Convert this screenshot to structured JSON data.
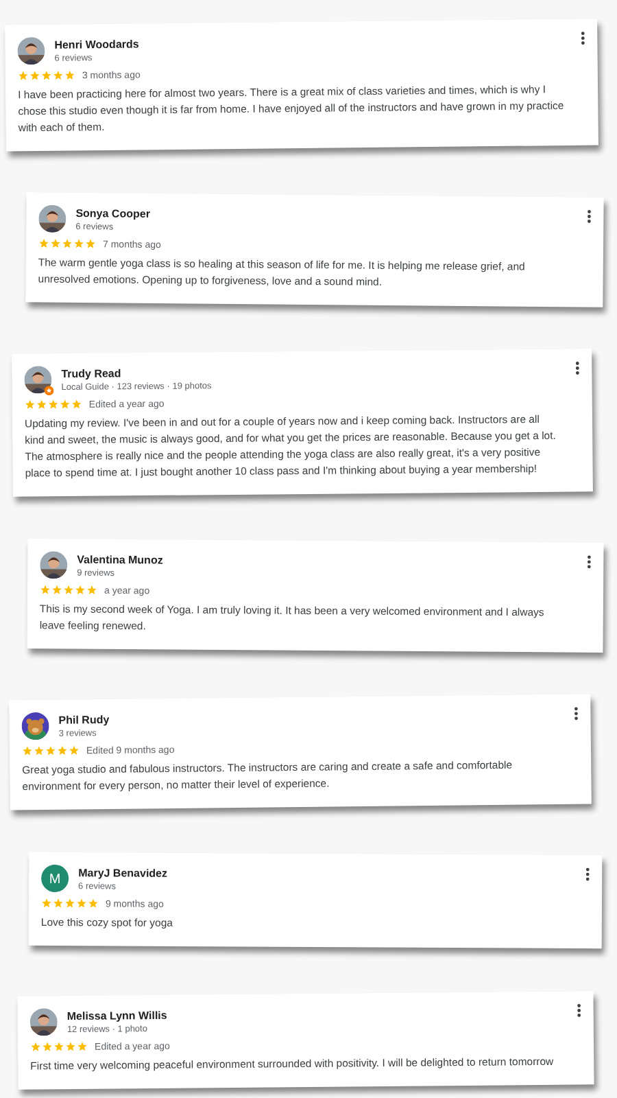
{
  "reviews": [
    {
      "name": "Henri Woodards",
      "meta": "6 reviews",
      "local_guide": false,
      "stars": 5,
      "time": "3 months ago",
      "text": "I have been practicing here for almost two years. There is a great mix of class varieties and times, which is why I chose this studio even though it is far from home. I have enjoyed all of the instructors and have grown in my practice with each of them."
    },
    {
      "name": "Sonya Cooper",
      "meta": "6 reviews",
      "local_guide": false,
      "stars": 5,
      "time": "7 months ago",
      "text": "The warm gentle yoga class is so healing at this season of life for me. It is helping me release grief, and unresolved emotions. Opening up to forgiveness, love and a sound mind."
    },
    {
      "name": "Trudy Read",
      "meta": "Local Guide · 123 reviews · 19 photos",
      "local_guide": true,
      "stars": 5,
      "time": "Edited a year ago",
      "text": "Updating my review. I've been in and out for a couple of years now and i keep coming back. Instructors are all kind and sweet, the music is always good, and for what you get the prices are reasonable. Because you get a lot. The atmosphere is really nice and the people attending the yoga class are also really great, it's a very positive place to spend time at. I just bought another 10 class pass and I'm thinking about buying a year membership!"
    },
    {
      "name": "Valentina Munoz",
      "meta": "9 reviews",
      "local_guide": false,
      "stars": 5,
      "time": "a year ago",
      "text": "This is my second week of Yoga. I am truly loving it. It has been a very welcomed environment and I always leave feeling renewed."
    },
    {
      "name": "Phil Rudy",
      "meta": "3 reviews",
      "avatar": {
        "kind": "cartoon"
      },
      "local_guide": false,
      "stars": 5,
      "time": "Edited 9 months ago",
      "text": "Great yoga studio and fabulous instructors. The instructors are caring and create a safe and comfortable environment for every person, no matter their level of experience."
    },
    {
      "name": "MaryJ Benavidez",
      "meta": "6 reviews",
      "avatar": {
        "kind": "letter",
        "letter": "M",
        "color": "#1e8a6e"
      },
      "local_guide": false,
      "stars": 5,
      "time": "9 months ago",
      "text": "Love this cozy spot for yoga"
    },
    {
      "name": "Melissa Lynn Willis",
      "meta": "12 reviews · 1 photo",
      "local_guide": false,
      "stars": 5,
      "time": "Edited a year ago",
      "text": "First time very welcoming peaceful environment surrounded with positivity. I will be delighted to return tomorrow"
    }
  ]
}
